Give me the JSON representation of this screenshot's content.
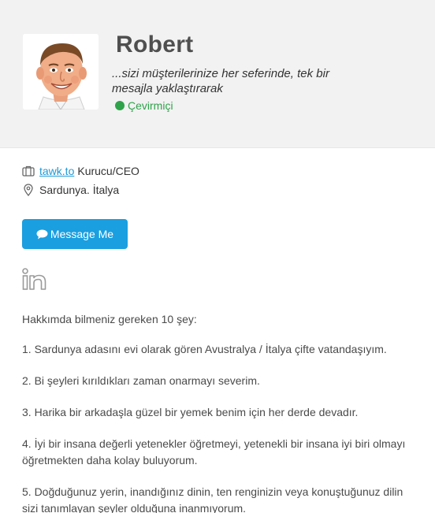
{
  "profile": {
    "name": "Robert",
    "tagline": "...sizi müşterilerinize her seferinde, tek bir mesajla yaklaştırarak",
    "status": "Çevirmiçi",
    "status_color": "#2fa34a"
  },
  "info": {
    "company_link": "tawk.to",
    "role": "Kurucu/CEO",
    "location": "Sardunya. İtalya"
  },
  "actions": {
    "message_label": "Message Me",
    "button_color": "#1a9fe0"
  },
  "icons": {
    "briefcase": "briefcase-icon",
    "location": "location-pin-icon",
    "chat": "chat-bubble-icon",
    "linkedin": "linkedin-icon"
  },
  "about": {
    "intro": "Hakkımda bilmeniz gereken 10 şey:",
    "items": [
      "1. Sardunya adasını evi olarak gören Avustralya / İtalya çifte vatandaşıyım.",
      "2. Bi şeyleri kırıldıkları zaman onarmayı severim.",
      "3. Harika bir arkadaşla güzel bir yemek benim için her derde devadır.",
      "4. İyi bir insana değerli yetenekler öğretmeyi, yetenekli bir insana iyi biri olmayı öğretmekten daha kolay buluyorum.",
      "5. Doğduğunuz yerin, inandığınız dinin, ten renginizin veya konuştuğunuz dilin sizi tanımlayan şeyler olduğuna inanmıyorum."
    ]
  }
}
